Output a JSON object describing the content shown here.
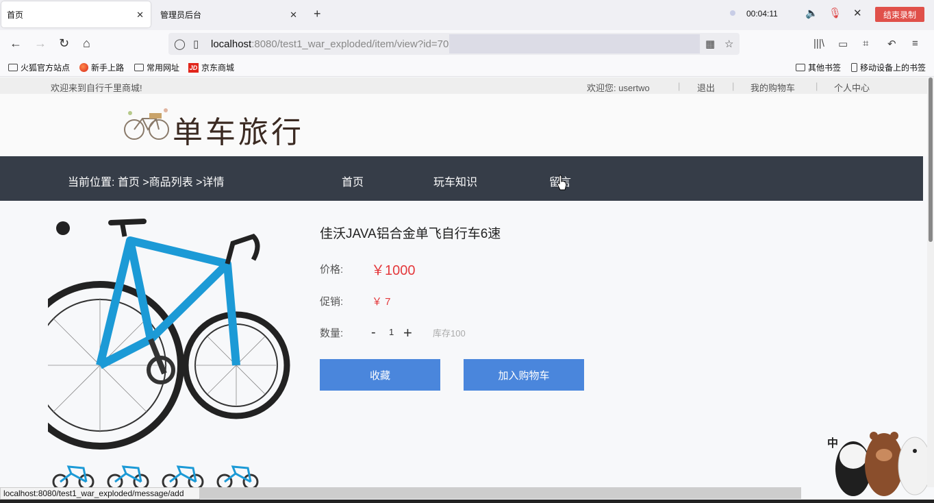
{
  "browser": {
    "tabs": [
      {
        "label": "首页",
        "active": true
      },
      {
        "label": "管理员后台",
        "active": false
      }
    ],
    "recorder": {
      "time": "00:04:11",
      "stop_label": "结束录制"
    },
    "url": {
      "host": "localhost",
      "rest": ":8080/test1_war_exploded/item/view?id=70"
    },
    "bookmarks": [
      "火狐官方站点",
      "新手上路",
      "常用网址",
      "京东商城"
    ],
    "bookmarks_right": [
      "其他书签",
      "移动设备上的书签"
    ],
    "status_url": "localhost:8080/test1_war_exploded/message/add"
  },
  "site": {
    "welcome": "欢迎来到自行千里商城!",
    "user_greeting": "欢迎您:  usertwo",
    "logout": "退出",
    "cart_link": "我的购物车",
    "profile_link": "个人中心",
    "logo_text": "单车旅行",
    "breadcrumb": "当前位置:  首页 >商品列表 >详情",
    "nav": [
      "首页",
      "玩车知识",
      "留言"
    ]
  },
  "product": {
    "title": "佳沃JAVA铝合金单飞自行车6速",
    "price_label": "价格:",
    "price": "￥1000",
    "promo_label": "促销:",
    "promo": "￥ 7",
    "qty_label": "数量:",
    "qty_minus": "-",
    "qty": "1",
    "qty_plus": "+",
    "stock": "库存100",
    "favorite_btn": "收藏",
    "cart_btn": "加入购物车"
  },
  "mascot_text": "中",
  "colors": {
    "nav_bg": "#363d48",
    "button": "#4a86dc",
    "price": "#e4393c",
    "record": "#e0504a"
  }
}
